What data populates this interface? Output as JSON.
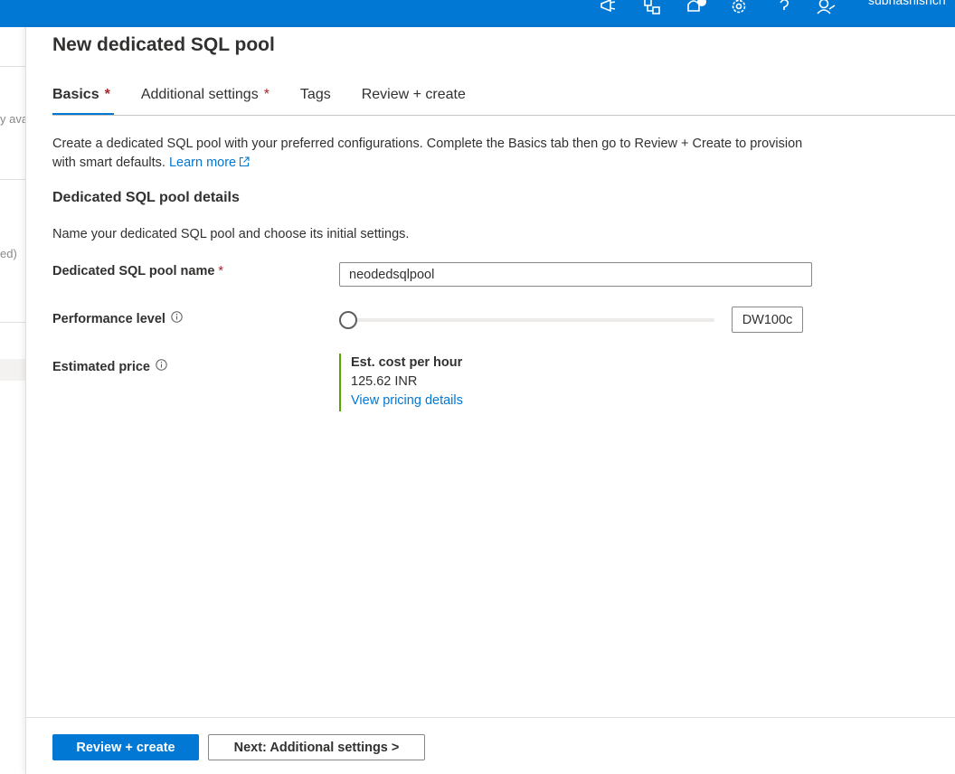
{
  "topbar": {
    "user_name": "subhashishch",
    "icons": [
      "feedback-icon",
      "directory-filter-icon",
      "notifications-icon",
      "settings-icon",
      "help-icon",
      "support-person-icon"
    ]
  },
  "background": {
    "fragments": [
      "y ava",
      "ed)"
    ]
  },
  "blade": {
    "title": "New dedicated SQL pool",
    "tabs": [
      {
        "label": "Basics",
        "required": "*"
      },
      {
        "label": "Additional settings",
        "required": "*"
      },
      {
        "label": "Tags",
        "required": ""
      },
      {
        "label": "Review + create",
        "required": ""
      }
    ],
    "intro": {
      "text": "Create a dedicated SQL pool with your preferred configurations. Complete the Basics tab then go to Review + Create to provision with smart defaults.",
      "link": "Learn more"
    },
    "section": {
      "title": "Dedicated SQL pool details",
      "description": "Name your dedicated SQL pool and choose its initial settings."
    },
    "fields": {
      "pool_name": {
        "label": "Dedicated SQL pool name",
        "required": "*",
        "value": "neodedsqlpool"
      },
      "performance": {
        "label": "Performance level",
        "value": "DW100c",
        "slider_fraction": 0.0
      },
      "price": {
        "label": "Estimated price",
        "heading": "Est. cost per hour",
        "amount": "125.62 INR",
        "link": "View pricing details"
      }
    }
  },
  "footer": {
    "primary_button": "Review + create",
    "secondary_button": "Next: Additional settings >"
  },
  "colors": {
    "accent": "#0078d4",
    "price_border": "#57a300",
    "required": "#a4262c"
  }
}
